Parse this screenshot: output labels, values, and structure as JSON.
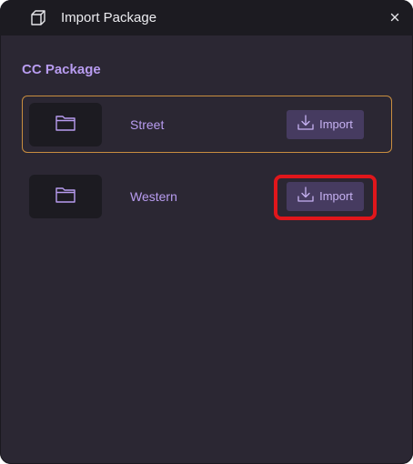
{
  "window": {
    "title": "Import Package",
    "title_icon": "cube-icon",
    "close_icon": "close-icon",
    "close_label": "×"
  },
  "section": {
    "title": "CC Package"
  },
  "packages": [
    {
      "name": "Street",
      "icon": "folder-icon",
      "import_label": "Import",
      "import_icon": "download-icon",
      "selected": true
    },
    {
      "name": "Western",
      "icon": "folder-icon",
      "import_label": "Import",
      "import_icon": "download-icon",
      "selected": false,
      "highlighted": true
    }
  ],
  "colors": {
    "accent": "#b89cf0",
    "selected_border": "#c98e3f",
    "highlight": "#e0161b",
    "panel_bg": "#2b2733",
    "titlebar_bg": "#1c1b21",
    "button_bg": "#463b60"
  }
}
